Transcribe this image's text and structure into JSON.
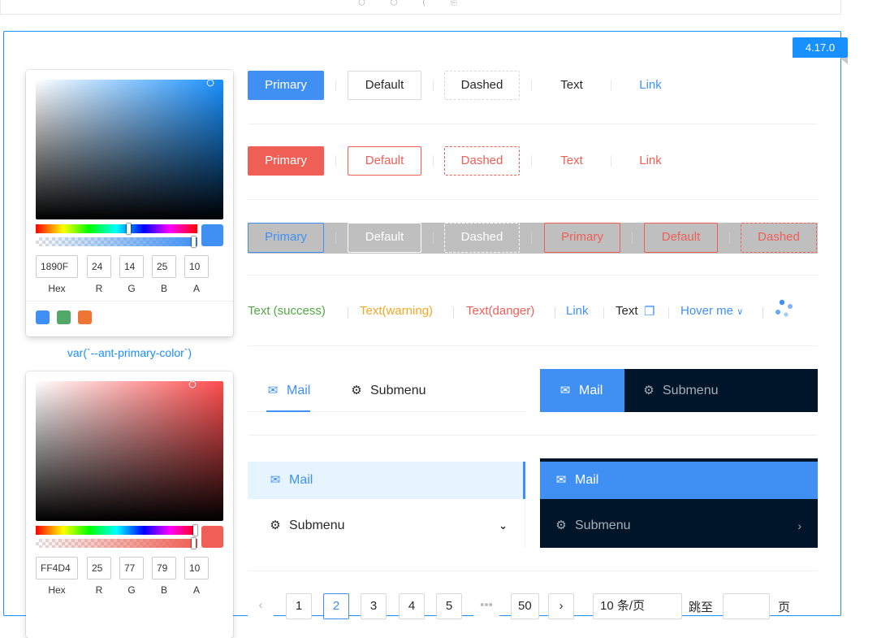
{
  "version_badge": "4.17.0",
  "pickers": [
    {
      "id": "primary",
      "sat_color": "#1890ff",
      "swatch_color": "#4090f4",
      "hue_handle_pct": 58,
      "hex": "1890F",
      "r": "24",
      "g": "14",
      "b": "25",
      "a": "10",
      "labels": {
        "hex": "Hex",
        "r": "R",
        "g": "G",
        "b": "B",
        "a": "A"
      },
      "presets": [
        "#4090f4",
        "#52a868",
        "#ef7534"
      ]
    },
    {
      "id": "error",
      "sat_color": "#ff4d4f",
      "swatch_color": "#ef5f55",
      "hue_handle_pct": 99,
      "hex": "FF4D4",
      "r": "25",
      "g": "77",
      "b": "79",
      "a": "10",
      "labels": {
        "hex": "Hex",
        "r": "R",
        "g": "G",
        "b": "B",
        "a": "A"
      },
      "presets": []
    }
  ],
  "picker_caption": "var(`--ant-primary-color`)",
  "colors": {
    "primary": "#4090f4",
    "danger": "#ef5f55",
    "success": "#52a842",
    "warning": "#f5a623",
    "dark_menu": "#001529"
  },
  "rows": {
    "primary_row": {
      "primary": "Primary",
      "default": "Default",
      "dashed": "Dashed",
      "text": "Text",
      "link": "Link"
    },
    "danger_row": {
      "primary": "Primary",
      "default": "Default",
      "dashed": "Dashed",
      "text": "Text",
      "link": "Link"
    },
    "ghost_row": {
      "primary": "Primary",
      "default": "Default",
      "dashed": "Dashed",
      "danger_primary": "Primary",
      "danger_default": "Default",
      "danger_dashed": "Dashed"
    }
  },
  "typography": {
    "success": "Text (success)",
    "warning": "Text(warning)",
    "danger": "Text(danger)",
    "link": "Link",
    "copyable": "Text",
    "dropdown": "Hover me"
  },
  "menus": {
    "mail": "Mail",
    "submenu": "Submenu"
  },
  "pagination": {
    "pages": [
      "1",
      "2",
      "3",
      "4",
      "5"
    ],
    "last": "50",
    "page_size": "10 条/页",
    "jump_prefix": "跳至",
    "jump_suffix": "页"
  }
}
